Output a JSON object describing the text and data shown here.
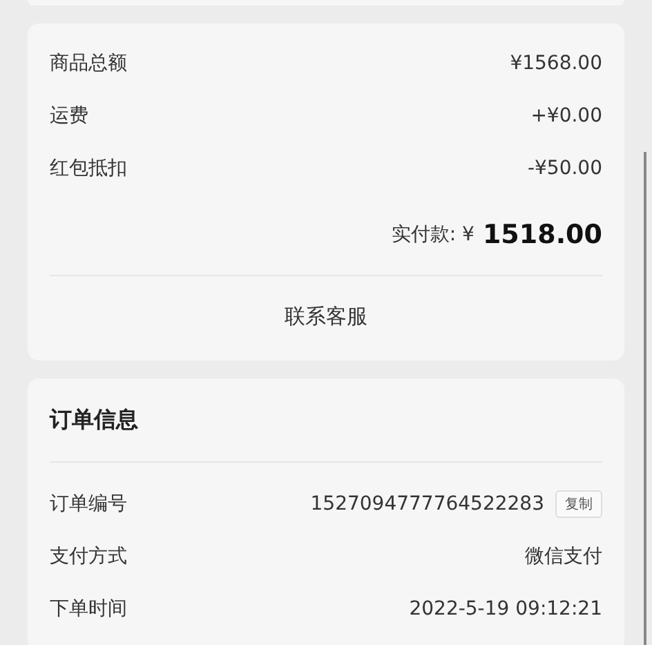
{
  "price_summary": {
    "rows": [
      {
        "label": "商品总额",
        "value": "¥1568.00"
      },
      {
        "label": "运费",
        "value": "+¥0.00"
      },
      {
        "label": "红包抵扣",
        "value": "-¥50.00"
      }
    ],
    "total": {
      "label": "实付款: ¥",
      "amount": "1518.00"
    },
    "contact_button": "联系客服"
  },
  "order_info": {
    "title": "订单信息",
    "rows": [
      {
        "label": "订单编号",
        "value": "1527094777764522283",
        "copy_button": "复制"
      },
      {
        "label": "支付方式",
        "value": "微信支付"
      },
      {
        "label": "下单时间",
        "value": "2022-5-19 09:12:21"
      }
    ]
  }
}
